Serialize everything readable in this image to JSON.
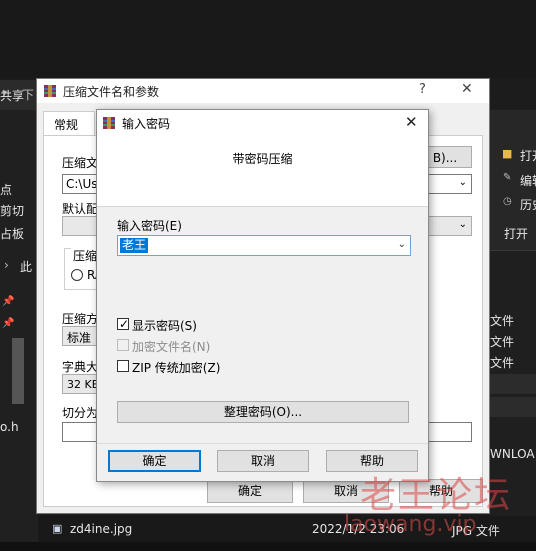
{
  "explorer": {
    "share_tab": "共享",
    "left_labels": [
      "点",
      "剪切",
      "占板"
    ],
    "breadcrumb_arrow": "›",
    "breadcrumb_text": "此",
    "left_file": "o.h",
    "right_labels": [
      "打开",
      "编辑",
      "历史",
      "打开"
    ],
    "right_file_types": [
      "文件",
      "文件",
      "文件"
    ],
    "right_download": "WNLOA",
    "bottom_file": "zd4ine.jpg",
    "bottom_date": "2022/1/2  23:06",
    "bottom_type": "JPG 文件",
    "top_tab_glyph": "下"
  },
  "archive_dialog": {
    "title": "压缩文件名和参数",
    "help": "?",
    "close": "✕",
    "tab_general": "常规",
    "archive_name_label": "压缩文",
    "archive_name_value": "C:\\Use",
    "browse_button": "B)...",
    "default_config_label": "默认配",
    "format_label": "压缩",
    "format_rar": "RA",
    "method_label": "压缩方",
    "method_value": "标准",
    "dict_label": "字典大",
    "dict_value": "32 KB",
    "split_label": "切分为",
    "ok": "确定",
    "cancel": "取消",
    "help_button": "帮助"
  },
  "password_dialog": {
    "title": "输入密码",
    "close": "✕",
    "header": "带密码压缩",
    "password_label": "输入密码(E)",
    "password_value": "老王",
    "show_password": "显示密码(S)",
    "show_password_checked": true,
    "encrypt_names": "加密文件名(N)",
    "encrypt_names_checked": false,
    "encrypt_names_disabled": true,
    "zip_legacy": "ZIP 传统加密(Z)",
    "zip_legacy_checked": false,
    "organize_button": "整理密码(O)...",
    "ok": "确定",
    "cancel": "取消",
    "help": "帮助"
  },
  "watermark": {
    "line1": "老王论坛",
    "line2": "laowang.vip"
  }
}
